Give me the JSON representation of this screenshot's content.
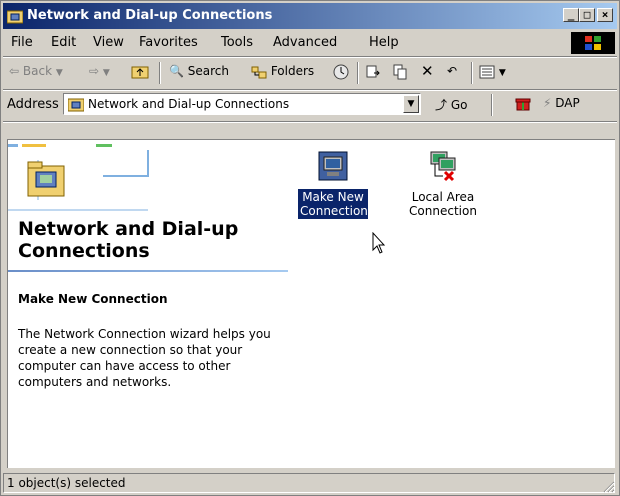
{
  "window": {
    "title": "Network and Dial-up Connections"
  },
  "menu": [
    "File",
    "Edit",
    "View",
    "Favorites",
    "Tools",
    "Advanced",
    "Help"
  ],
  "toolbar": {
    "back": "Back",
    "forward": "",
    "search": "Search",
    "folders": "Folders"
  },
  "address": {
    "label": "Address",
    "value": "Network and Dial-up Connections",
    "go": "Go",
    "dap": "DAP"
  },
  "panel": {
    "title": "Network and Dial-up Connections",
    "heading": "Make New Connection",
    "description": "The Network Connection wizard helps you create a new connection so that your computer can have access to other computers and networks."
  },
  "items": [
    {
      "label": "Make New Connection",
      "selected": true
    },
    {
      "label": "Local Area Connection",
      "selected": false
    }
  ],
  "status": {
    "text": "1 object(s) selected"
  },
  "colors": {
    "titlebar": "#0a246a",
    "selection": "#0a246a",
    "face": "#d4d0c8"
  }
}
